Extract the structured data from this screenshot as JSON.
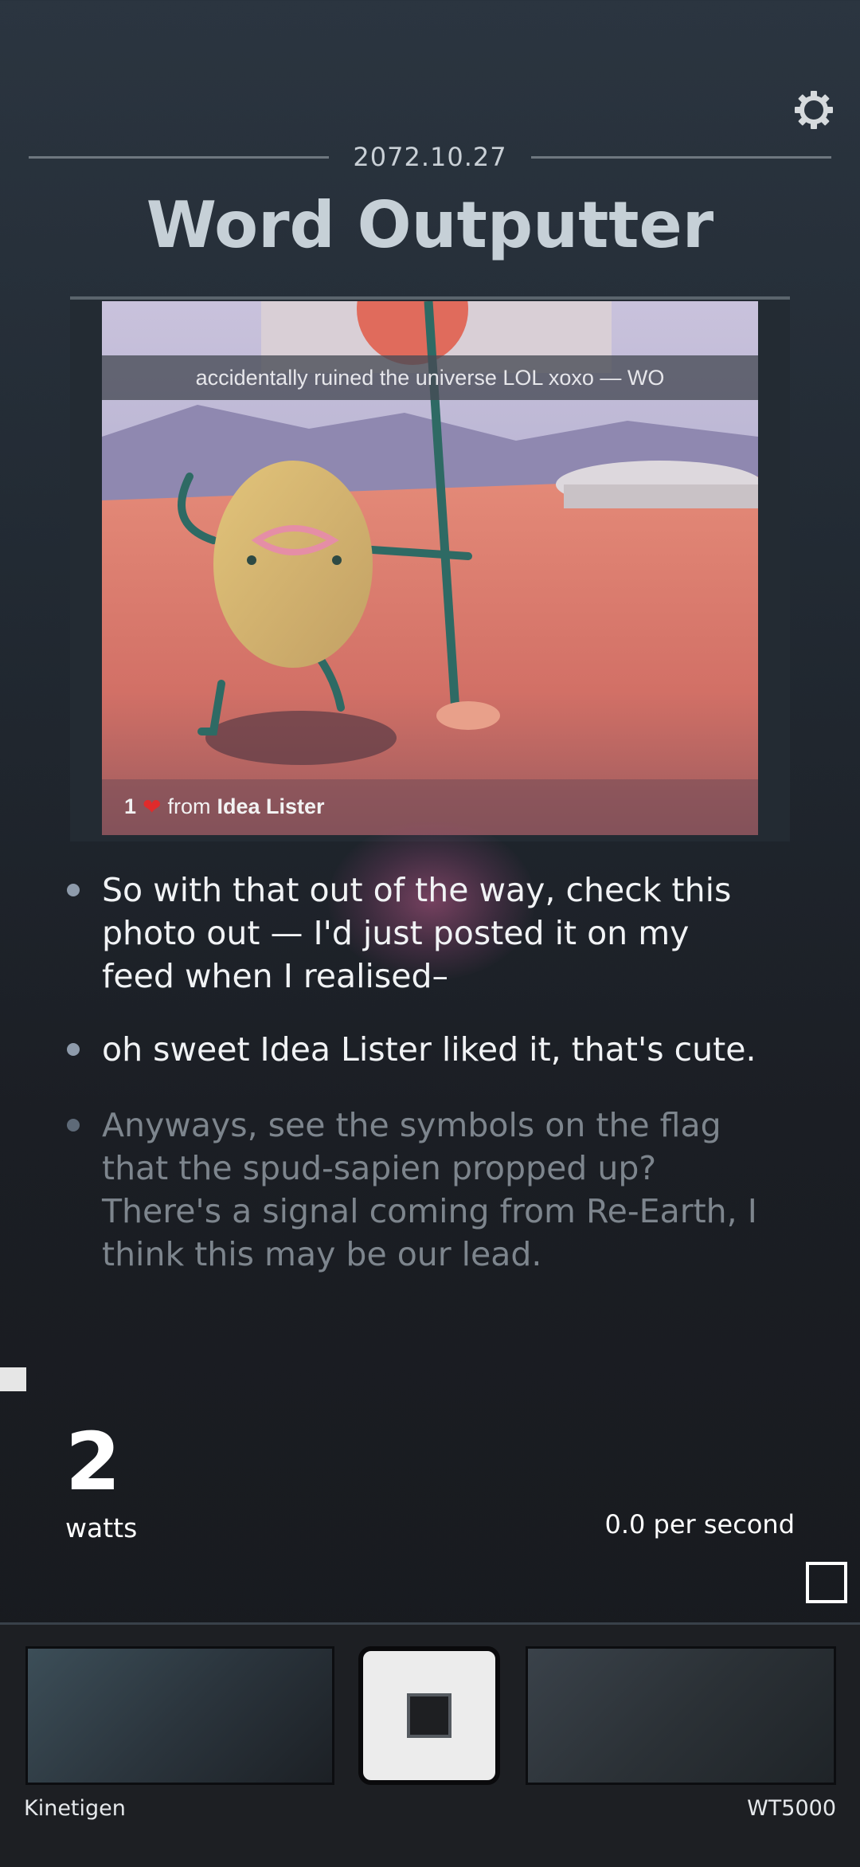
{
  "header": {
    "date": "2072.10.27",
    "title": "Word Outputter",
    "settings_icon": "gear-icon"
  },
  "post": {
    "caption": "accidentally ruined the universe LOL xoxo — WO",
    "likes_count": "1",
    "likes_from": "from",
    "liker_name": "Idea Lister",
    "heart_icon": "heart-icon"
  },
  "bullets": [
    {
      "text": "So with that out of the way, check this photo out — I'd just posted it on my feed when I realised–"
    },
    {
      "text": "oh sweet Idea Lister liked it, that's cute."
    },
    {
      "text": "Anyways, see the symbols on the flag that the spud-sapien propped up? There's a signal coming from Re-Earth, I think this may be our lead."
    }
  ],
  "stats": {
    "watts_value": "2",
    "watts_label": "watts",
    "rate": "0.0 per second"
  },
  "generators": {
    "left_label": "Kinetigen",
    "right_label": "WT5000"
  },
  "colors": {
    "background_top": "#2b3540",
    "background_bottom": "#17191d",
    "title": "#c6d0d7",
    "heart": "#e02b2b",
    "dim_text": "#7d858d"
  }
}
